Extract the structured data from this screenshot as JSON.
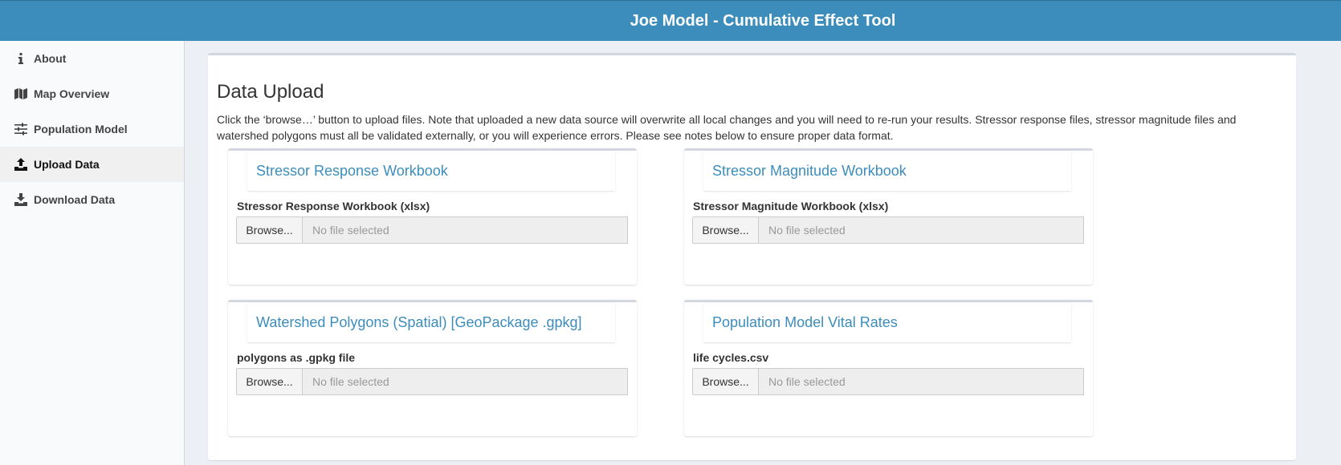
{
  "header": {
    "title": "Joe Model - Cumulative Effect Tool"
  },
  "sidebar": {
    "items": [
      {
        "label": "About",
        "icon": "info-icon"
      },
      {
        "label": "Map Overview",
        "icon": "map-icon"
      },
      {
        "label": "Population Model",
        "icon": "sliders-icon"
      },
      {
        "label": "Upload Data",
        "icon": "upload-icon",
        "active": true
      },
      {
        "label": "Download Data",
        "icon": "download-icon"
      }
    ]
  },
  "main": {
    "title": "Data Upload",
    "description": "Click the ‘browse…’ button to upload files. Note that uploaded a new data source will overwrite all local changes and you will need to re-run your results. Stressor response files, stressor magnitude files and watershed polygons must all be validated externally, or you will experience errors. Please see notes below to ensure proper data format.",
    "cards": [
      {
        "title": "Stressor Response Workbook",
        "label": "Stressor Response Workbook (xlsx)",
        "button": "Browse...",
        "placeholder": "No file selected"
      },
      {
        "title": "Stressor Magnitude Workbook",
        "label": "Stressor Magnitude Workbook (xlsx)",
        "button": "Browse...",
        "placeholder": "No file selected"
      },
      {
        "title": "Watershed Polygons (Spatial) [GeoPackage .gpkg]",
        "label": "polygons as .gpkg file",
        "button": "Browse...",
        "placeholder": "No file selected"
      },
      {
        "title": "Population Model Vital Rates",
        "label": "life cycles.csv",
        "button": "Browse...",
        "placeholder": "No file selected"
      }
    ]
  },
  "colors": {
    "header_bg": "#3c8dbc",
    "accent": "#3c8dbc",
    "sidebar_bg": "#f9fafc",
    "content_bg": "#ecf0f5"
  }
}
